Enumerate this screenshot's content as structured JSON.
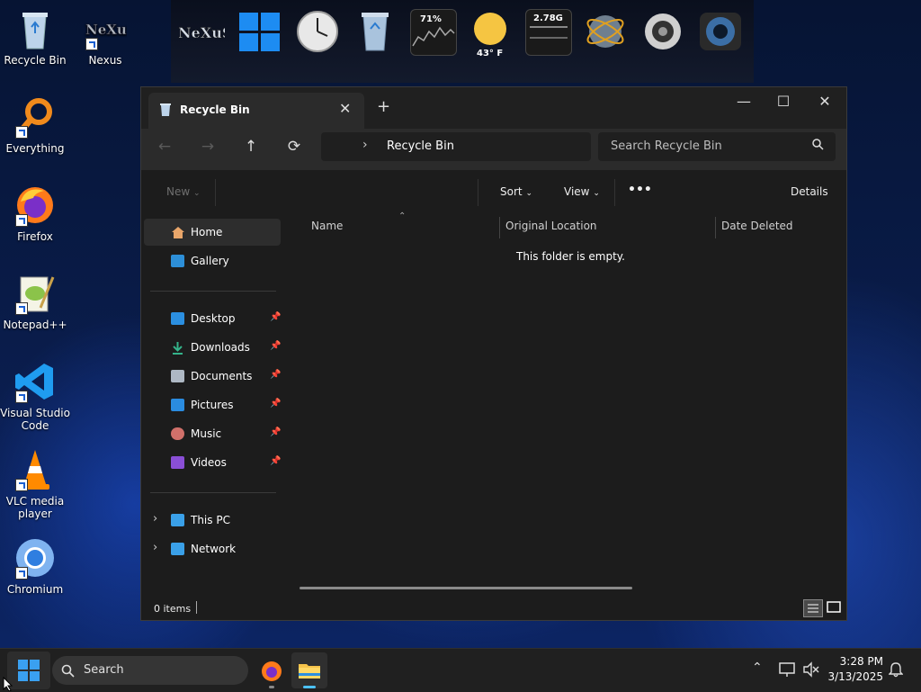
{
  "desktop": {
    "icons": [
      {
        "label": "Recycle Bin"
      },
      {
        "label": "Nexus"
      },
      {
        "label": "Everything"
      },
      {
        "label": "Firefox"
      },
      {
        "label": "Notepad++"
      },
      {
        "label": "Visual Studio Code"
      },
      {
        "label": "VLC media player"
      },
      {
        "label": "Chromium"
      }
    ]
  },
  "dock": {
    "logo_text": "NeXuS",
    "cpu_percent": "71%",
    "weather_temp": "43° F",
    "memory_label": "2.78G",
    "icons": [
      "nexus-logo-icon",
      "windows-logo-icon",
      "clock-icon",
      "recycle-bin-icon",
      "cpu-meter-icon",
      "weather-icon",
      "memory-meter-icon",
      "internet-globe-icon",
      "speaker-icon",
      "camera-icon"
    ]
  },
  "window": {
    "tab_title": "Recycle Bin",
    "breadcrumb": "Recycle Bin",
    "search_placeholder": "Search Recycle Bin",
    "toolbar": {
      "new": "New",
      "sort": "Sort",
      "view": "View",
      "more": "•••",
      "details": "Details"
    },
    "sidebar": {
      "top": [
        {
          "label": "Home"
        },
        {
          "label": "Gallery"
        }
      ],
      "pinned": [
        {
          "label": "Desktop"
        },
        {
          "label": "Downloads"
        },
        {
          "label": "Documents"
        },
        {
          "label": "Pictures"
        },
        {
          "label": "Music"
        },
        {
          "label": "Videos"
        }
      ],
      "drives": [
        {
          "label": "This PC"
        },
        {
          "label": "Network"
        }
      ]
    },
    "columns": [
      "Name",
      "Original Location",
      "Date Deleted"
    ],
    "empty_message": "This folder is empty.",
    "status": "0 items"
  },
  "taskbar": {
    "search_label": "Search",
    "time": "3:28 PM",
    "date": "3/13/2025"
  },
  "colors": {
    "accent": "#0078d4",
    "window_bg": "#1c1c1c",
    "taskbar_bg": "#202020"
  }
}
